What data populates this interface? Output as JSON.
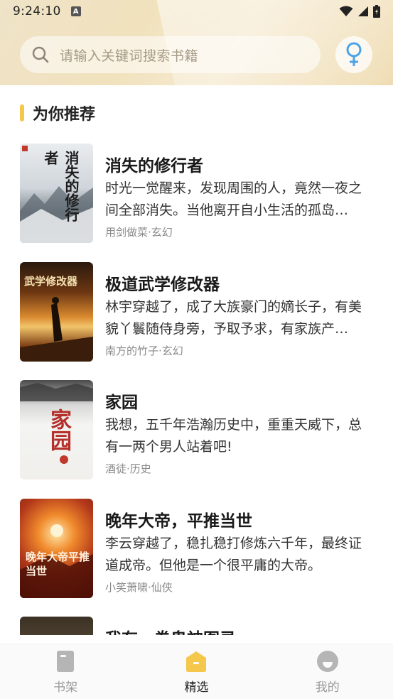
{
  "status_bar": {
    "time": "9:24:10",
    "notification_letter": "A"
  },
  "search": {
    "placeholder": "请输入关键词搜索书籍"
  },
  "gender_toggle": {
    "icon": "female-icon",
    "color": "#4aa3e8"
  },
  "section": {
    "title": "为你推荐",
    "accent": "#f5c74a"
  },
  "books": [
    {
      "title": "消失的修行者",
      "description": "时光一觉醒来，发现周围的人，竟然一夜之间全部消失。当他离开自小生活的孤岛…",
      "meta": "用剑做菜·玄幻",
      "cover_text": "消失的修行者"
    },
    {
      "title": "极道武学修改器",
      "description": "林宇穿越了，成了大族豪门的嫡长子，有美貌丫鬟随侍身旁，予取予求，有家族产…",
      "meta": "南方的竹子·玄幻",
      "cover_text": "武学修改器"
    },
    {
      "title": "家园",
      "description": "我想，五千年浩瀚历史中，重重天威下，总有一两个男人站着吧!",
      "meta": "酒徒·历史",
      "cover_text": "家园"
    },
    {
      "title": "晚年大帝，平推当世",
      "description": "李云穿越了，稳扎稳打修炼六千年，最终证道成帝。但他是一个很平庸的大帝。",
      "meta": "小笑萧啸·仙侠",
      "cover_text": "晚年大帝平推当世"
    },
    {
      "title": "我有一卷鬼神图录",
      "description": "",
      "meta": "",
      "cover_text": ""
    }
  ],
  "nav": {
    "items": [
      {
        "label": "书架",
        "icon": "bookshelf-icon"
      },
      {
        "label": "精选",
        "icon": "featured-home-icon",
        "active": true
      },
      {
        "label": "我的",
        "icon": "profile-icon"
      }
    ],
    "active_color": "#f5c74a",
    "inactive_color": "#b5b5b5"
  }
}
